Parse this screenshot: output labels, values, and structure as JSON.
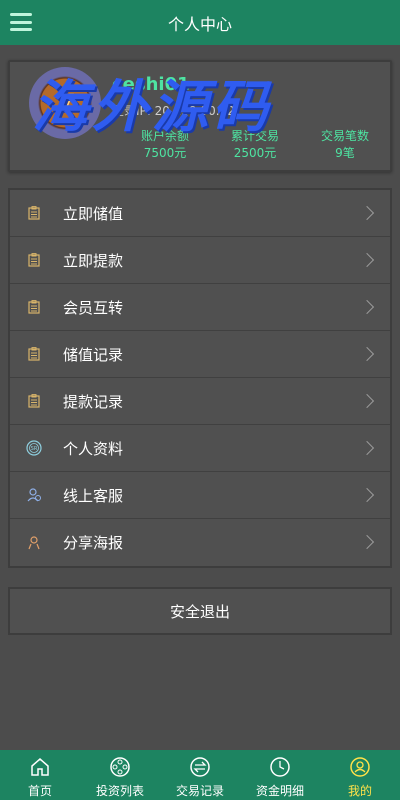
{
  "header": {
    "title": "个人中心"
  },
  "profile": {
    "username": "ceshi01",
    "login_ip": "登录IP: 20.239.90.12",
    "stats": [
      {
        "label": "账户余额",
        "value": "7500元"
      },
      {
        "label": "累计交易",
        "value": "2500元"
      },
      {
        "label": "交易笔数",
        "value": "9笔"
      }
    ]
  },
  "watermark": "海外源码",
  "menu": [
    {
      "label": "立即储值",
      "icon": "document-icon"
    },
    {
      "label": "立即提款",
      "icon": "document-icon"
    },
    {
      "label": "会员互转",
      "icon": "document-icon"
    },
    {
      "label": "储值记录",
      "icon": "document-icon"
    },
    {
      "label": "提款记录",
      "icon": "document-icon"
    },
    {
      "label": "个人资料",
      "icon": "profile-badge-icon"
    },
    {
      "label": "线上客服",
      "icon": "customer-service-icon"
    },
    {
      "label": "分享海报",
      "icon": "share-person-icon"
    }
  ],
  "logout": {
    "label": "安全退出"
  },
  "tabbar": [
    {
      "label": "首页",
      "icon": "home-icon"
    },
    {
      "label": "投资列表",
      "icon": "film-reel-icon"
    },
    {
      "label": "交易记录",
      "icon": "exchange-icon"
    },
    {
      "label": "资金明细",
      "icon": "clock-icon"
    },
    {
      "label": "我的",
      "icon": "user-icon",
      "active": true
    }
  ],
  "colors": {
    "header_bg": "#1d8461",
    "accent_green": "#4ee4a2",
    "active_tab": "#ffe24a",
    "page_bg": "#4c4c4c"
  }
}
